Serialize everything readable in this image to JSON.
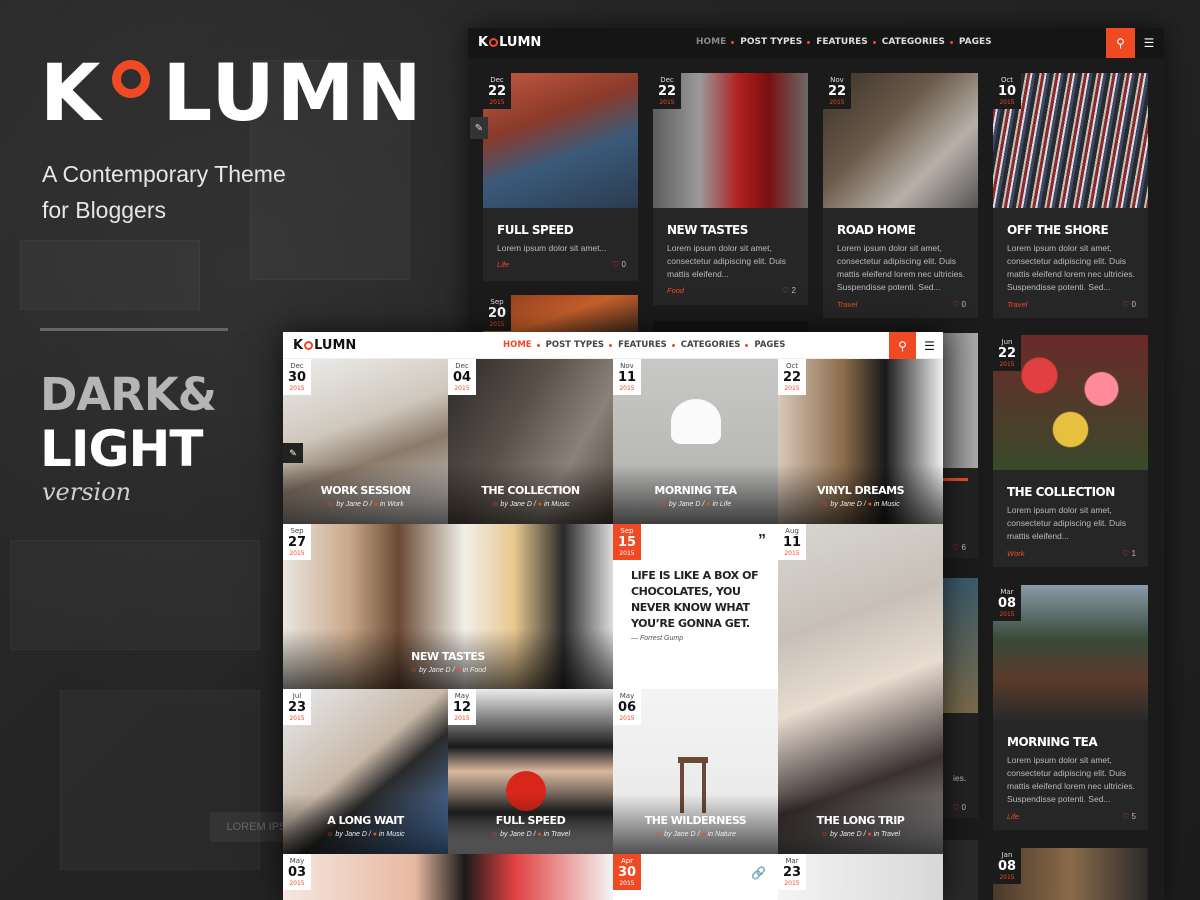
{
  "hero": {
    "logo_left": "K",
    "logo_right": "LUMN",
    "tagline_line1": "A Contemporary Theme",
    "tagline_line2": "for Bloggers",
    "dark_label": "DARK&",
    "light_label": "LIGHT",
    "version_label": "version",
    "bg_lorem": "LOREM IPSUM"
  },
  "colors": {
    "accent": "#f04a24",
    "dark_bg": "#1b1b1b",
    "light_bg": "#ffffff"
  },
  "dark_nav": {
    "logo_left": "K",
    "logo_right": "LUMN",
    "menu": [
      "HOME",
      "POST TYPES",
      "FEATURES",
      "CATEGORIES",
      "PAGES"
    ],
    "search_icon": "search-icon",
    "menu_icon": "hamburger-icon"
  },
  "dark_posts": [
    {
      "month": "Dec",
      "day": "22",
      "year": "2015",
      "title": "FULL SPEED",
      "excerpt": "Lorem ipsum dolor sit amet...",
      "category": "Life",
      "likes": "0"
    },
    {
      "month": "Dec",
      "day": "22",
      "year": "2015",
      "title": "NEW TASTES",
      "excerpt": "Lorem ipsum dolor sit amet, consectetur adipiscing elit. Duis mattis eleifend...",
      "category": "Food",
      "likes": "2"
    },
    {
      "month": "Nov",
      "day": "22",
      "year": "2015",
      "title": "ROAD HOME",
      "excerpt": "Lorem ipsum dolor sit amet, consectetur adipiscing elit. Duis mattis eleifend lorem nec ultricies. Suspendisse potenti. Sed...",
      "category": "Travel",
      "likes": "0"
    },
    {
      "month": "Oct",
      "day": "10",
      "year": "2015",
      "title": "OFF THE SHORE",
      "excerpt": "Lorem ipsum dolor sit amet, consectetur adipiscing elit. Duis mattis eleifend lorem nec ultricies. Suspendisse potenti. Sed...",
      "category": "Travel",
      "likes": "0"
    },
    {
      "month": "Jun",
      "day": "22",
      "year": "2015",
      "title": "THE COLLECTION",
      "excerpt": "Lorem ipsum dolor sit amet, consectetur adipiscing elit. Duis mattis eleifend...",
      "category": "Work",
      "likes": "1"
    },
    {
      "month": "Mar",
      "day": "08",
      "year": "2015",
      "title": "MORNING TEA",
      "excerpt": "Lorem ipsum dolor sit amet, consectetur adipiscing elit. Duis mattis eleifend lorem nec ultricies. Suspendisse potenti. Sed...",
      "category": "Life",
      "likes": "5"
    }
  ],
  "dark_partial": [
    {
      "month": "Sep",
      "day": "20",
      "year": "2015"
    },
    {
      "month": "Jan",
      "day": "08",
      "year": "2015"
    }
  ],
  "dark_peek_likes": [
    "6",
    "0"
  ],
  "dark_peek_text": "ies.",
  "light_nav": {
    "logo_left": "K",
    "logo_right": "LUMN",
    "menu": [
      "HOME",
      "POST TYPES",
      "FEATURES",
      "CATEGORIES",
      "PAGES"
    ]
  },
  "author": "by Jane D",
  "light_posts": [
    {
      "month": "Dec",
      "day": "30",
      "year": "2015",
      "title": "WORK SESSION",
      "category": "in Work"
    },
    {
      "month": "Dec",
      "day": "04",
      "year": "2015",
      "title": "THE COLLECTION",
      "category": "in Music"
    },
    {
      "month": "Nov",
      "day": "11",
      "year": "2015",
      "title": "MORNING TEA",
      "category": "in Life"
    },
    {
      "month": "Oct",
      "day": "22",
      "year": "2015",
      "title": "VINYL DREAMS",
      "category": "in Music"
    },
    {
      "month": "Sep",
      "day": "27",
      "year": "2015",
      "title": "NEW TASTES",
      "category": "in Food"
    },
    {
      "month": "Jul",
      "day": "23",
      "year": "2015",
      "title": "A LONG WAIT",
      "category": "in Music"
    },
    {
      "month": "May",
      "day": "12",
      "year": "2015",
      "title": "FULL SPEED",
      "category": "in Travel"
    },
    {
      "month": "May",
      "day": "06",
      "year": "2015",
      "title": "THE WILDERNESS",
      "category": "in Nature"
    },
    {
      "month": "Aug",
      "day": "11",
      "year": "2015",
      "title": "THE LONG TRIP",
      "category": "in Travel"
    }
  ],
  "light_quote": {
    "month": "Sep",
    "day": "15",
    "year": "2015",
    "text": "LIFE IS LIKE A BOX OF CHOCOLATES, YOU NEVER KNOW WHAT YOU’RE GONNA GET.",
    "author": "— Forrest Gump"
  },
  "light_bottom": [
    {
      "month": "May",
      "day": "03",
      "year": "2015"
    },
    {
      "month": "Apr",
      "day": "30",
      "year": "2015"
    },
    {
      "month": "Mar",
      "day": "23",
      "year": "2015"
    }
  ]
}
